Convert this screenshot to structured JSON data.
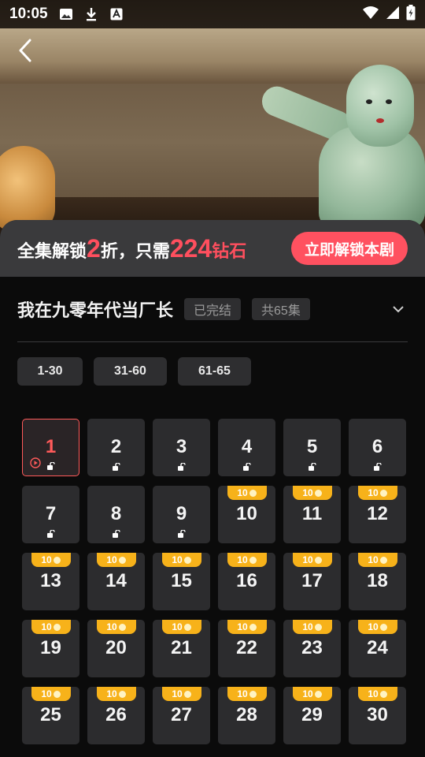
{
  "status_bar": {
    "time": "10:05",
    "left_icons": [
      "image-icon",
      "download-icon",
      "font-icon"
    ],
    "right_icons": [
      "wifi-icon",
      "signal-icon",
      "battery-charging-icon"
    ]
  },
  "promo": {
    "prefix": "全集解锁",
    "discount": "2",
    "discount_suffix": "折，只需",
    "price": "224",
    "price_suffix": "钻石",
    "button_label": "立即解锁本剧"
  },
  "drama": {
    "title": "我在九零年代当厂长",
    "status_tag": "已完结",
    "count_tag": "共65集"
  },
  "ranges": [
    "1-30",
    "31-60",
    "61-65"
  ],
  "episodes": {
    "coin_cost": "10",
    "items": [
      {
        "n": "1",
        "free": true,
        "active": true
      },
      {
        "n": "2",
        "free": true
      },
      {
        "n": "3",
        "free": true
      },
      {
        "n": "4",
        "free": true
      },
      {
        "n": "5",
        "free": true
      },
      {
        "n": "6",
        "free": true
      },
      {
        "n": "7",
        "free": true
      },
      {
        "n": "8",
        "free": true
      },
      {
        "n": "9",
        "free": true
      },
      {
        "n": "10",
        "free": false
      },
      {
        "n": "11",
        "free": false
      },
      {
        "n": "12",
        "free": false
      },
      {
        "n": "13",
        "free": false
      },
      {
        "n": "14",
        "free": false
      },
      {
        "n": "15",
        "free": false
      },
      {
        "n": "16",
        "free": false
      },
      {
        "n": "17",
        "free": false
      },
      {
        "n": "18",
        "free": false
      },
      {
        "n": "19",
        "free": false
      },
      {
        "n": "20",
        "free": false
      },
      {
        "n": "21",
        "free": false
      },
      {
        "n": "22",
        "free": false
      },
      {
        "n": "23",
        "free": false
      },
      {
        "n": "24",
        "free": false
      },
      {
        "n": "25",
        "free": false
      },
      {
        "n": "26",
        "free": false
      },
      {
        "n": "27",
        "free": false
      },
      {
        "n": "28",
        "free": false
      },
      {
        "n": "29",
        "free": false
      },
      {
        "n": "30",
        "free": false
      }
    ]
  }
}
